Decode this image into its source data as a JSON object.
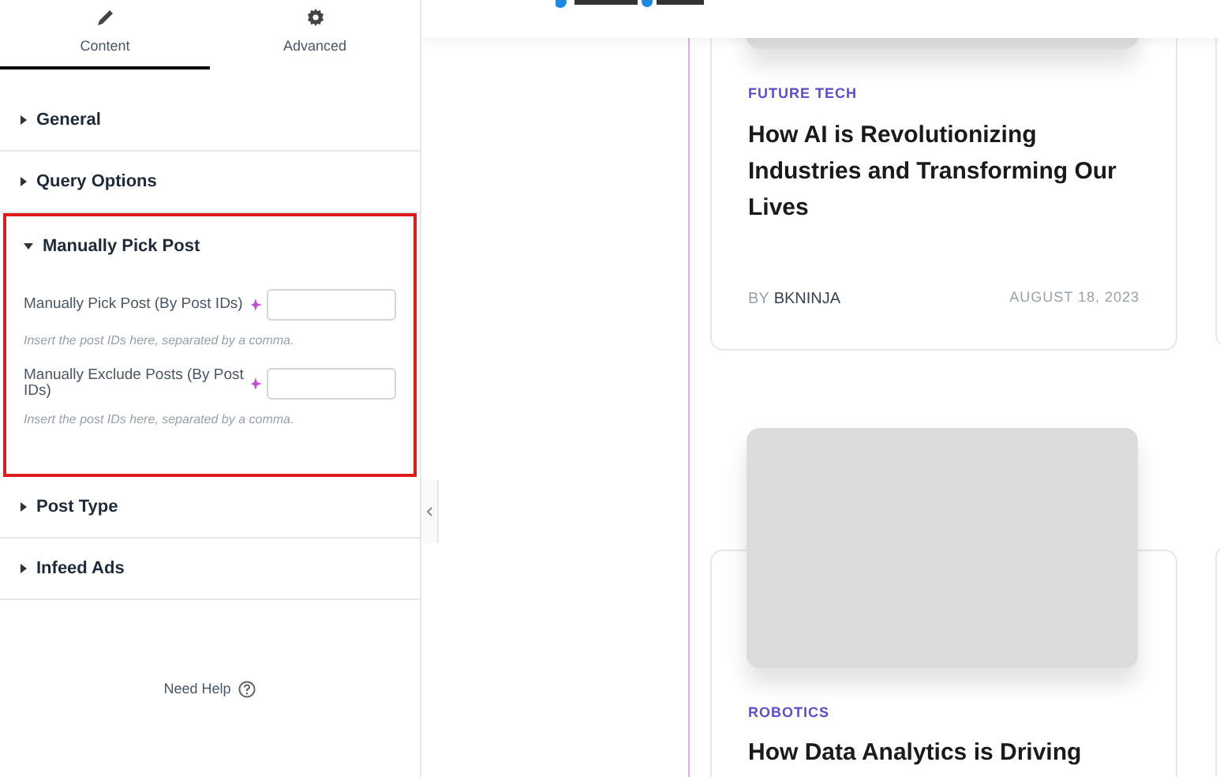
{
  "tabs": [
    {
      "label": "Content",
      "selected": true
    },
    {
      "label": "Advanced",
      "selected": false
    }
  ],
  "sections": [
    {
      "title": "General",
      "expanded": false
    },
    {
      "title": "Query Options",
      "expanded": false
    },
    {
      "title": "Manually Pick Post",
      "expanded": true,
      "highlighted": true,
      "fields": [
        {
          "label": "Manually Pick Post (By Post IDs)",
          "hint": "Insert the post IDs here, separated by a comma."
        },
        {
          "label": "Manually Exclude Posts (By Post IDs)",
          "hint": "Insert the post IDs here, separated by a comma."
        }
      ]
    },
    {
      "title": "Post Type",
      "expanded": false
    },
    {
      "title": "Infeed Ads",
      "expanded": false
    }
  ],
  "help": {
    "label": "Need Help"
  },
  "cards": [
    {
      "category": "FUTURE TECH",
      "title": "How AI is Revolutionizing Industries and Transforming Our Lives",
      "author_prefix": "BY",
      "author": "BKNINJA",
      "date": "AUGUST 18, 2023"
    },
    {
      "category": "ROBOTICS",
      "title": "How Data Analytics is Driving"
    }
  ]
}
